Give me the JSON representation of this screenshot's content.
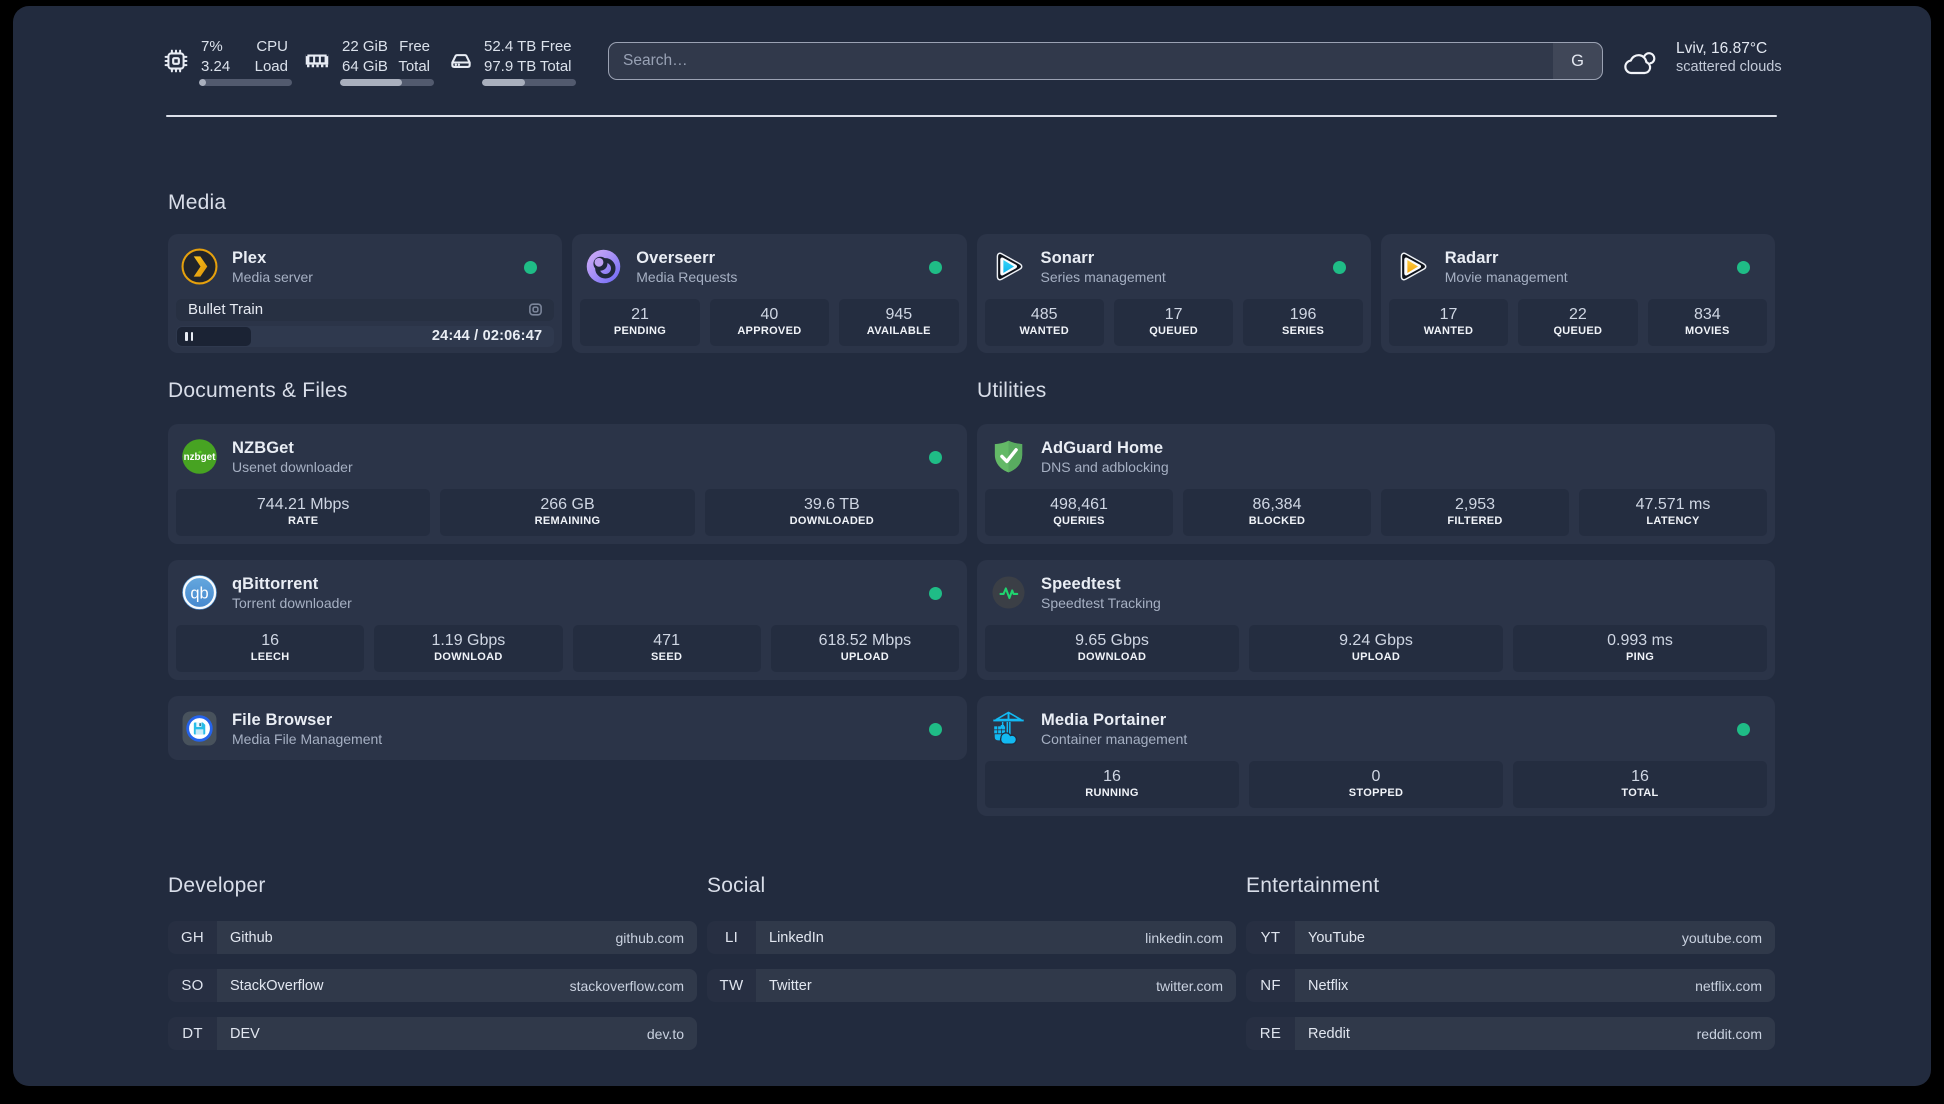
{
  "topbar": {
    "resources": [
      {
        "icon": "cpu-icon",
        "col1": [
          "7%",
          "3.24"
        ],
        "col2": [
          "CPU",
          "Load"
        ],
        "progress": 7
      },
      {
        "icon": "memory-icon",
        "col1": [
          "22 GiB",
          "64 GiB"
        ],
        "col2": [
          "Free",
          "Total"
        ],
        "progress": 65.6
      },
      {
        "icon": "disk-icon",
        "col1": [
          "52.4 TB",
          "97.9 TB"
        ],
        "col2": [
          "Free",
          "Total"
        ],
        "progress": 46.5
      }
    ],
    "search": {
      "placeholder": "Search…",
      "button_label": "G"
    },
    "weather": {
      "icon": "scattered-clouds-icon",
      "line1": "Lviv, 16.87°C",
      "line2": "scattered clouds"
    }
  },
  "groups": {
    "media": {
      "title": "Media",
      "services": [
        {
          "name": "Plex",
          "description": "Media server",
          "icon": "plex-logo",
          "online": true,
          "player": {
            "title": "Bullet Train",
            "time": "24:44 / 02:06:47",
            "progress": 19.5
          }
        },
        {
          "name": "Overseerr",
          "description": "Media Requests",
          "icon": "overseerr-logo",
          "online": true,
          "stats": [
            {
              "value": "21",
              "label": "PENDING"
            },
            {
              "value": "40",
              "label": "APPROVED"
            },
            {
              "value": "945",
              "label": "AVAILABLE"
            }
          ]
        },
        {
          "name": "Sonarr",
          "description": "Series management",
          "icon": "sonarr-logo",
          "online": true,
          "stats": [
            {
              "value": "485",
              "label": "WANTED"
            },
            {
              "value": "17",
              "label": "QUEUED"
            },
            {
              "value": "196",
              "label": "SERIES"
            }
          ]
        },
        {
          "name": "Radarr",
          "description": "Movie management",
          "icon": "radarr-logo",
          "online": true,
          "stats": [
            {
              "value": "17",
              "label": "WANTED"
            },
            {
              "value": "22",
              "label": "QUEUED"
            },
            {
              "value": "834",
              "label": "MOVIES"
            }
          ]
        }
      ]
    },
    "documents": {
      "title": "Documents & Files",
      "services": [
        {
          "name": "NZBGet",
          "description": "Usenet downloader",
          "icon": "nzbget-logo",
          "online": true,
          "stats": [
            {
              "value": "744.21 Mbps",
              "label": "RATE"
            },
            {
              "value": "266 GB",
              "label": "REMAINING"
            },
            {
              "value": "39.6 TB",
              "label": "DOWNLOADED"
            }
          ]
        },
        {
          "name": "qBittorrent",
          "description": "Torrent downloader",
          "icon": "qbittorrent-logo",
          "online": true,
          "stats": [
            {
              "value": "16",
              "label": "LEECH"
            },
            {
              "value": "1.19 Gbps",
              "label": "DOWNLOAD"
            },
            {
              "value": "471",
              "label": "SEED"
            },
            {
              "value": "618.52 Mbps",
              "label": "UPLOAD"
            }
          ]
        },
        {
          "name": "File Browser",
          "description": "Media File Management",
          "icon": "filebrowser-logo",
          "online": true
        }
      ]
    },
    "utilities": {
      "title": "Utilities",
      "services": [
        {
          "name": "AdGuard Home",
          "description": "DNS and adblocking",
          "icon": "adguard-logo",
          "online": false,
          "stats": [
            {
              "value": "498,461",
              "label": "QUERIES"
            },
            {
              "value": "86,384",
              "label": "BLOCKED"
            },
            {
              "value": "2,953",
              "label": "FILTERED"
            },
            {
              "value": "47.571 ms",
              "label": "LATENCY"
            }
          ]
        },
        {
          "name": "Speedtest",
          "description": "Speedtest Tracking",
          "icon": "speedtest-logo",
          "online": false,
          "stats": [
            {
              "value": "9.65 Gbps",
              "label": "DOWNLOAD"
            },
            {
              "value": "9.24 Gbps",
              "label": "UPLOAD"
            },
            {
              "value": "0.993 ms",
              "label": "PING"
            }
          ]
        },
        {
          "name": "Media Portainer",
          "description": "Container management",
          "icon": "portainer-logo",
          "online": true,
          "stats": [
            {
              "value": "16",
              "label": "RUNNING"
            },
            {
              "value": "0",
              "label": "STOPPED"
            },
            {
              "value": "16",
              "label": "TOTAL"
            }
          ]
        }
      ]
    }
  },
  "bookmarks": [
    {
      "title": "Developer",
      "items": [
        {
          "abbr": "GH",
          "name": "Github",
          "url": "github.com"
        },
        {
          "abbr": "SO",
          "name": "StackOverflow",
          "url": "stackoverflow.com"
        },
        {
          "abbr": "DT",
          "name": "DEV",
          "url": "dev.to"
        }
      ]
    },
    {
      "title": "Social",
      "items": [
        {
          "abbr": "LI",
          "name": "LinkedIn",
          "url": "linkedin.com"
        },
        {
          "abbr": "TW",
          "name": "Twitter",
          "url": "twitter.com"
        }
      ]
    },
    {
      "title": "Entertainment",
      "items": [
        {
          "abbr": "YT",
          "name": "YouTube",
          "url": "youtube.com"
        },
        {
          "abbr": "NF",
          "name": "Netflix",
          "url": "netflix.com"
        },
        {
          "abbr": "RE",
          "name": "Reddit",
          "url": "reddit.com"
        }
      ]
    }
  ],
  "colors": {
    "page_bg": "#222B3E",
    "card_bg": "#2B3448",
    "stat_bg": "#242D40",
    "status_online": "#1FBC86",
    "accent_gold": "#E8A00C",
    "divider": "#DCE0EA"
  }
}
